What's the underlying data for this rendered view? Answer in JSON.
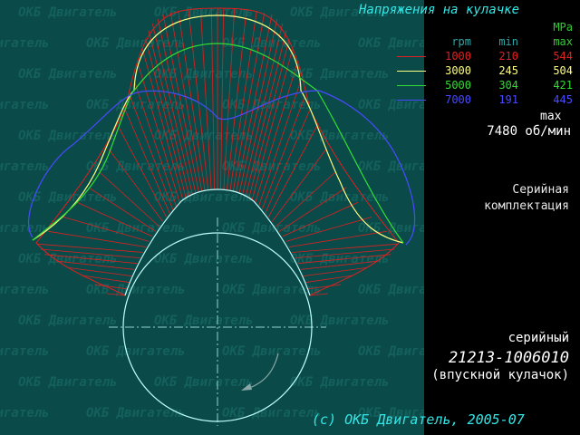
{
  "title": "Напряжения на кулачке",
  "watermark_text": "ОКБ Двигатель",
  "legend": {
    "unit": "MPa",
    "col_rpm": "rpm",
    "col_min": "min",
    "col_max": "max",
    "rows": [
      {
        "rpm": "1000",
        "min": "210",
        "max": "544",
        "color": "#e02020"
      },
      {
        "rpm": "3000",
        "min": "245",
        "max": "504",
        "color": "#ffff80"
      },
      {
        "rpm": "5000",
        "min": "304",
        "max": "421",
        "color": "#33dd33"
      },
      {
        "rpm": "7000",
        "min": "191",
        "max": "445",
        "color": "#4a4aff"
      }
    ]
  },
  "max_label": "max",
  "max_value": "7480 об/мин",
  "config": {
    "line1": "Серийная",
    "line2": "комплектация"
  },
  "serial_label": "серийный",
  "part_number": "21213-1006010",
  "part_desc": "(впускной кулачок)",
  "copyright": "(c) ОКБ Двигатель, 2005-07",
  "colors": {
    "background": "#0a4a48",
    "panel": "#000000",
    "cam": "#bfffff",
    "accent": "#33e6e6"
  }
}
